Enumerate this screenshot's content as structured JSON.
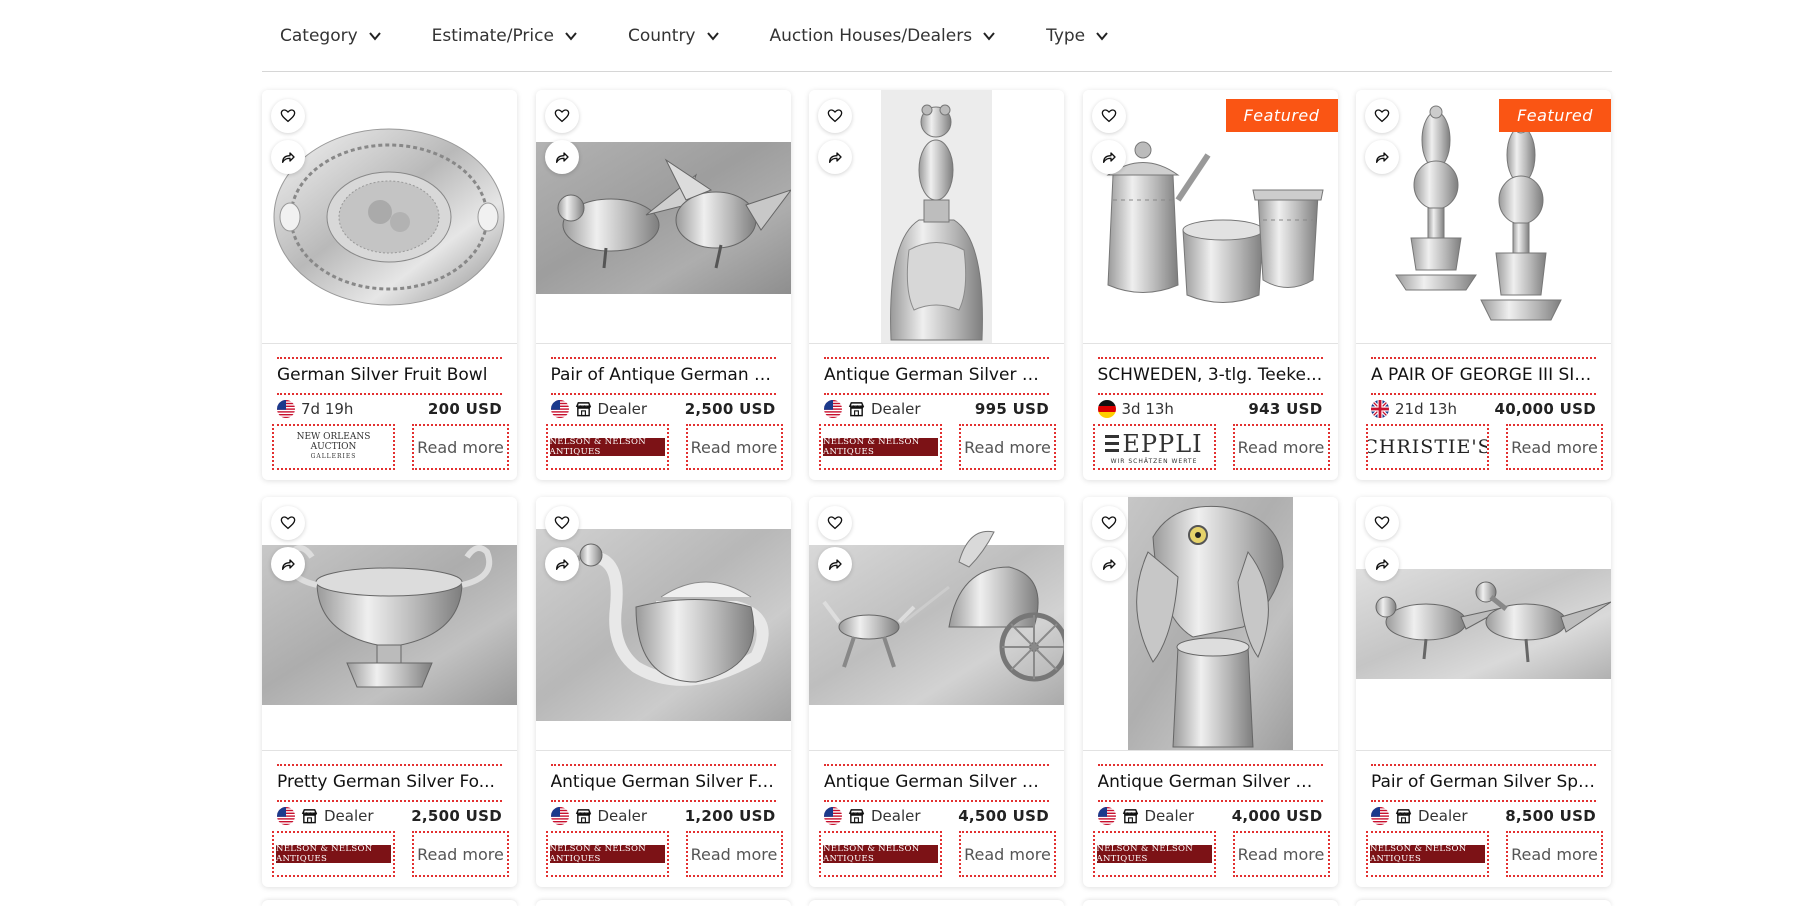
{
  "filters": [
    {
      "label": "Category"
    },
    {
      "label": "Estimate/Price"
    },
    {
      "label": "Country"
    },
    {
      "label": "Auction Houses/Dealers"
    },
    {
      "label": "Type"
    }
  ],
  "colors": {
    "accent": "#e23030",
    "featured": "#fa5514",
    "nelson_logo": "#7c1216"
  },
  "read_more_label": "Read more",
  "featured_label": "Featured",
  "items": [
    {
      "title": "German Silver Fruit Bowl",
      "country": "us",
      "meta": "7d 19h",
      "meta_type": "time",
      "price": "200 USD",
      "logo": "neworleans",
      "logo_text": "NEW ORLEANS AUCTION",
      "logo_subtext": "GALLERIES",
      "featured": false,
      "image": "bowl"
    },
    {
      "title": "Pair of Antique German S...",
      "country": "us",
      "meta": "Dealer",
      "meta_type": "dealer",
      "price": "2,500 USD",
      "logo": "nelson",
      "logo_text": "NELSON & NELSON ANTIQUES",
      "featured": false,
      "image": "birds"
    },
    {
      "title": "Antique German Silver D...",
      "country": "us",
      "meta": "Dealer",
      "meta_type": "dealer",
      "price": "995 USD",
      "logo": "nelson",
      "logo_text": "NELSON & NELSON ANTIQUES",
      "featured": false,
      "image": "bell"
    },
    {
      "title": "SCHWEDEN, 3-tlg. Teeke...",
      "country": "de",
      "meta": "3d 13h",
      "meta_type": "time",
      "price": "943 USD",
      "logo": "eppli",
      "logo_text": "EPPLI",
      "logo_subtext": "WIR SCHÄTZEN WERTE",
      "featured": true,
      "image": "teaset"
    },
    {
      "title": "A PAIR OF GEORGE III SIL...",
      "country": "gb",
      "meta": "21d 13h",
      "meta_type": "time",
      "price": "40,000 USD",
      "logo": "christies",
      "logo_text": "CHRISTIE'S",
      "featured": true,
      "image": "urns"
    },
    {
      "title": "Pretty German Silver Fo...",
      "country": "us",
      "meta": "Dealer",
      "meta_type": "dealer",
      "price": "2,500 USD",
      "logo": "nelson",
      "logo_text": "NELSON & NELSON ANTIQUES",
      "featured": false,
      "image": "urnbowl"
    },
    {
      "title": "Antique German Silver Fi...",
      "country": "us",
      "meta": "Dealer",
      "meta_type": "dealer",
      "price": "1,200 USD",
      "logo": "nelson",
      "logo_text": "NELSON & NELSON ANTIQUES",
      "featured": false,
      "image": "swan"
    },
    {
      "title": "Antique German Silver R...",
      "country": "us",
      "meta": "Dealer",
      "meta_type": "dealer",
      "price": "4,500 USD",
      "logo": "nelson",
      "logo_text": "NELSON & NELSON ANTIQUES",
      "featured": false,
      "image": "chariot"
    },
    {
      "title": "Antique German Silver H...",
      "country": "us",
      "meta": "Dealer",
      "meta_type": "dealer",
      "price": "4,000 USD",
      "logo": "nelson",
      "logo_text": "NELSON & NELSON ANTIQUES",
      "featured": false,
      "image": "doghead"
    },
    {
      "title": "Pair of German Silver Spi...",
      "country": "us",
      "meta": "Dealer",
      "meta_type": "dealer",
      "price": "8,500 USD",
      "logo": "nelson",
      "logo_text": "NELSON & NELSON ANTIQUES",
      "featured": false,
      "image": "pheasants"
    }
  ]
}
